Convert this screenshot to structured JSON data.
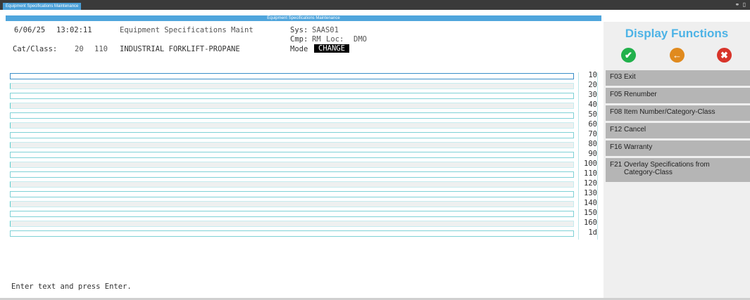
{
  "window": {
    "tab_label": "Equipment Specifications Maintenance",
    "title": "Equipment Specifications Maintenance",
    "icons": [
      "link-icon",
      "document-icon"
    ]
  },
  "header": {
    "date": "6/06/25",
    "time": "13:02:11",
    "program": "Equipment Specifications Maint",
    "sys_label": "Sys:",
    "sys_value": "SAAS01",
    "cmp_label": "Cmp:",
    "cmp_value": "RM",
    "loc_label": "Loc:",
    "loc_value": "DMO",
    "catclass_label": "Cat/Class:",
    "cat": "20",
    "class": "110",
    "description": "INDUSTRIAL FORKLIFT-PROPANE",
    "mode_label": "Mode",
    "mode_value": "CHANGE"
  },
  "lines": [
    "10",
    "20",
    "30",
    "40",
    "50",
    "60",
    "70",
    "80",
    "90",
    "100",
    "110",
    "120",
    "130",
    "140",
    "150",
    "160",
    "1d"
  ],
  "footer": {
    "message": "Enter text and press Enter."
  },
  "panel": {
    "title": "Display Functions",
    "buttons": [
      "check-icon",
      "back-arrow-icon",
      "close-x-icon"
    ],
    "functions": [
      {
        "key": "F03",
        "label": "Exit"
      },
      {
        "key": "F05",
        "label": "Renumber"
      },
      {
        "key": "F08",
        "label": "Item Number/Category-Class"
      },
      {
        "key": "F12",
        "label": "Cancel"
      },
      {
        "key": "F16",
        "label": "Warranty"
      },
      {
        "key": "F21",
        "label": "Overlay Specifications from Category-Class"
      }
    ]
  },
  "colors": {
    "accent": "#4db3e6",
    "ok": "#22b14c",
    "back": "#e08a1e",
    "close": "#d8342a"
  }
}
